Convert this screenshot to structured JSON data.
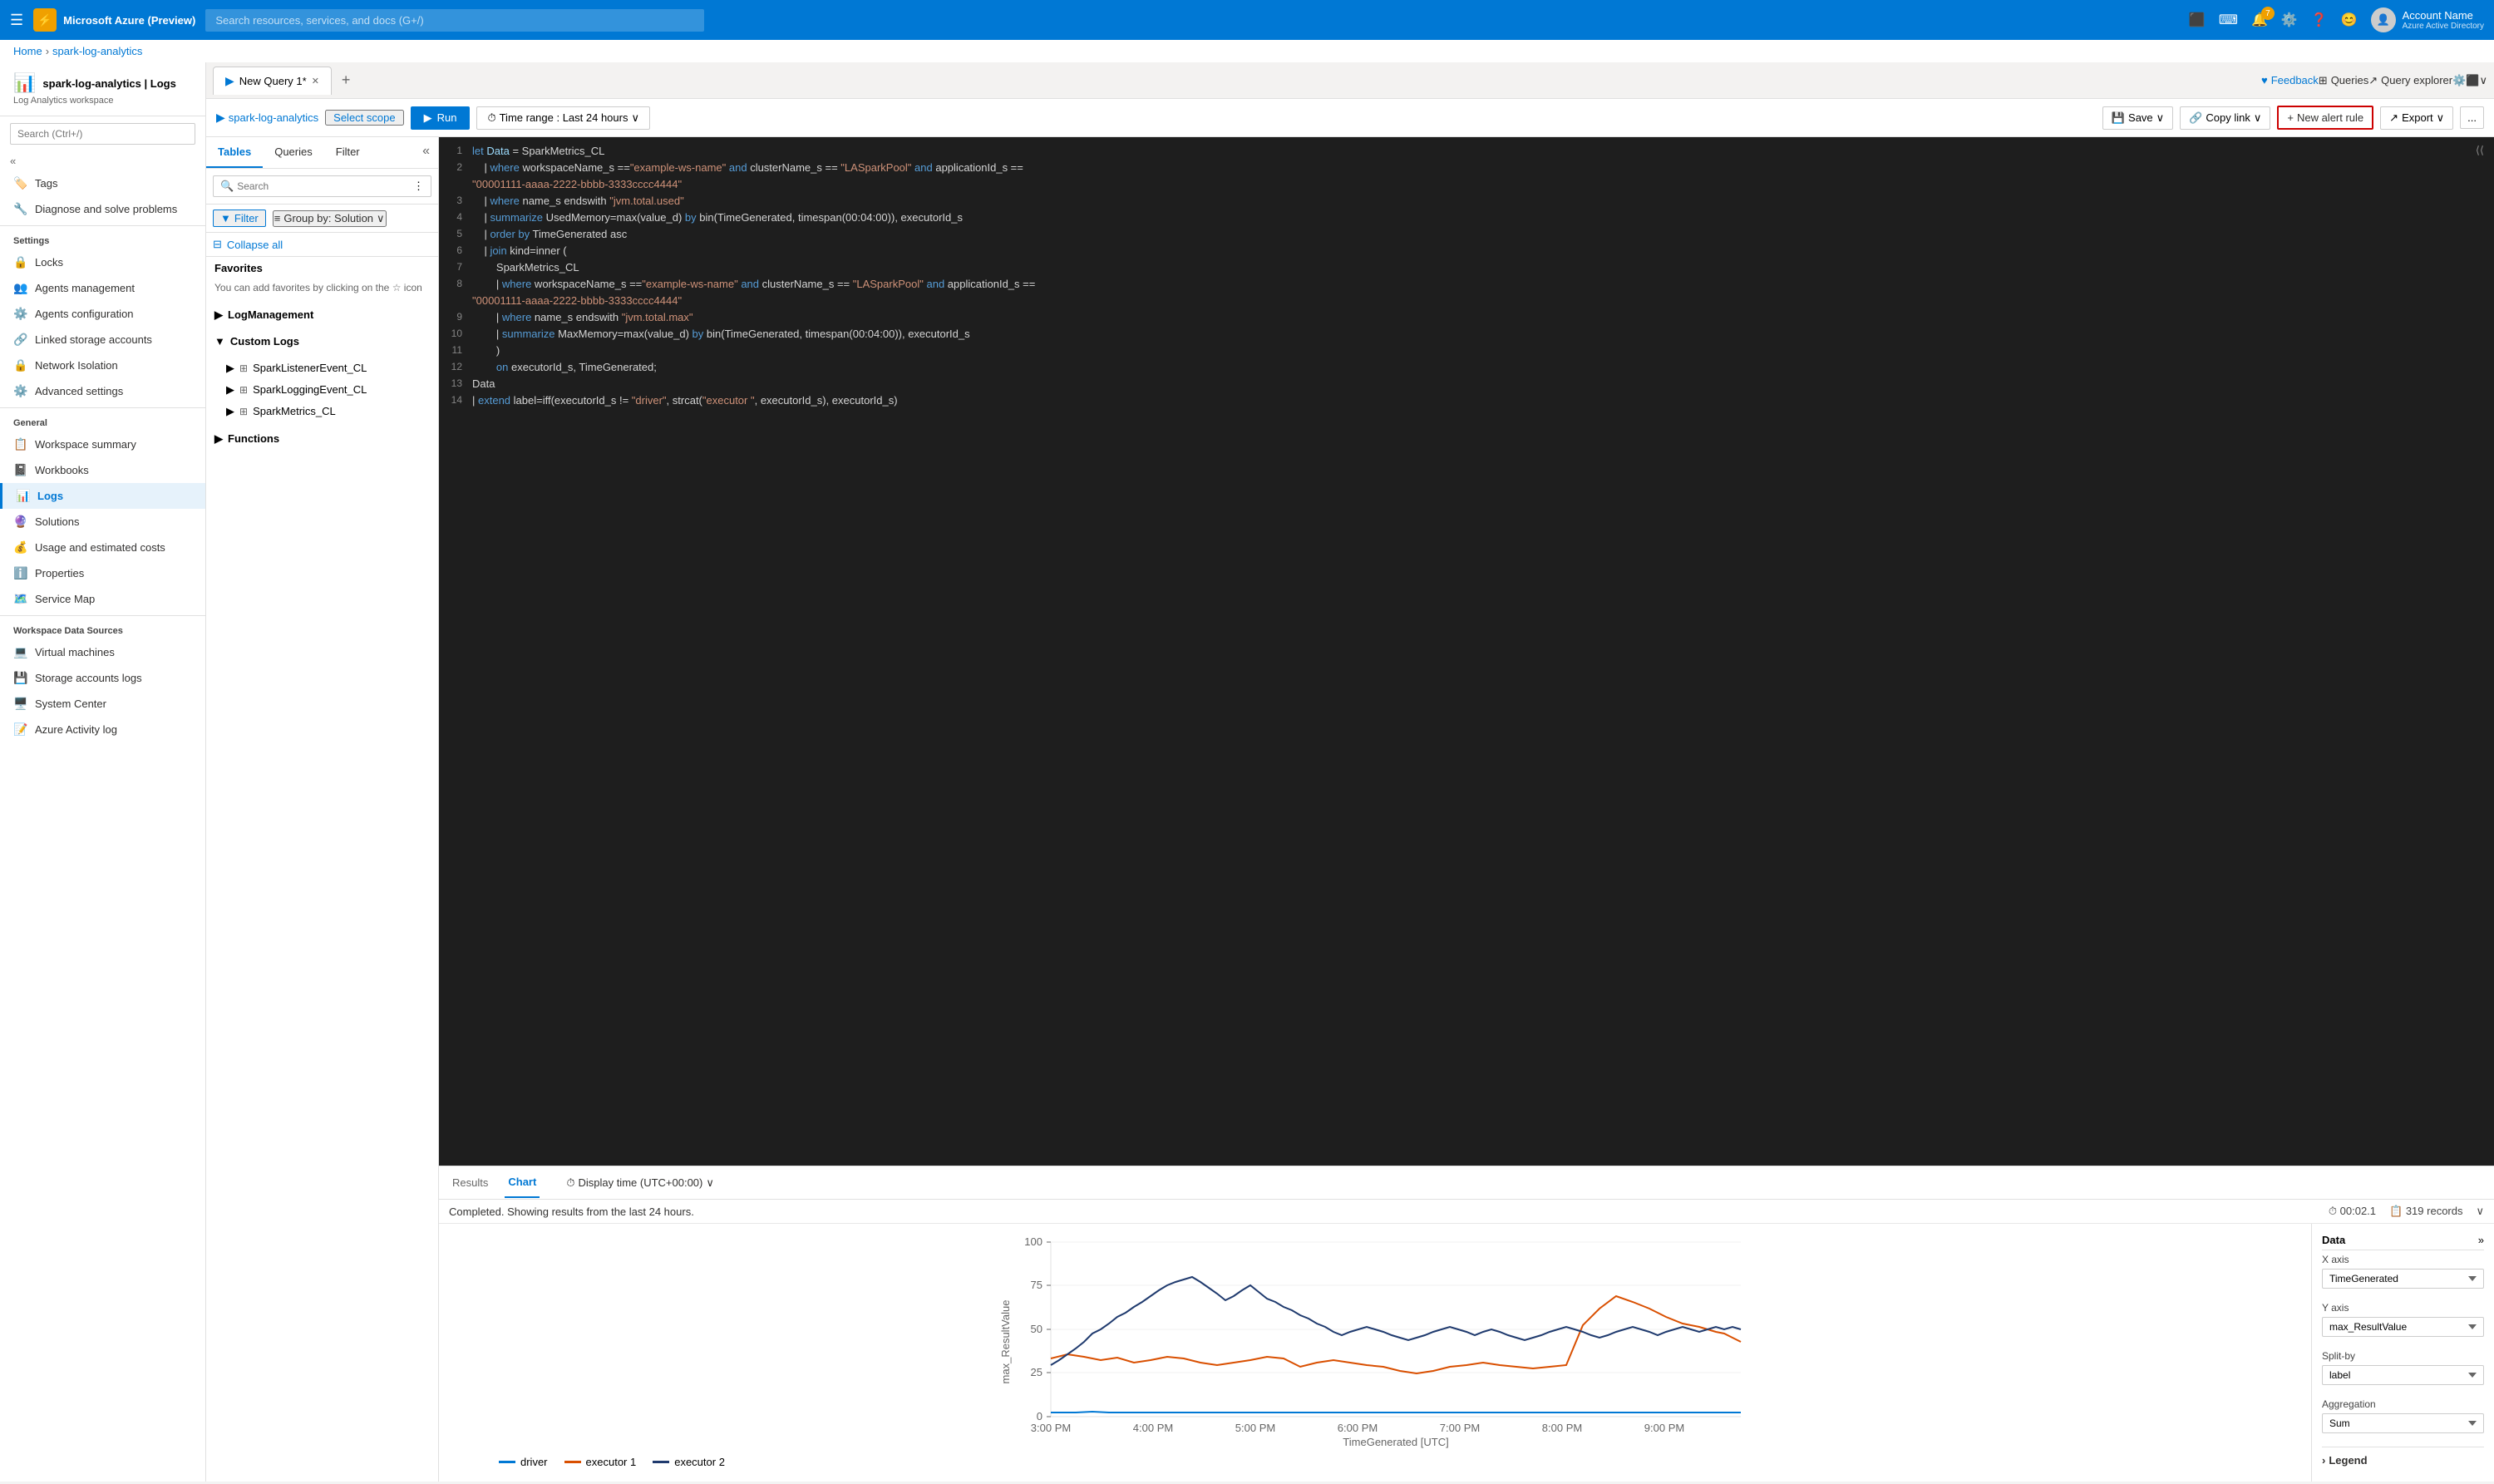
{
  "topbar": {
    "logo_icon": "⚡",
    "logo_text": "Microsoft Azure (Preview)",
    "search_placeholder": "Search resources, services, and docs (G+/)",
    "notification_count": "7",
    "account_name": "Account Name",
    "account_sub": "Azure Active Directory"
  },
  "breadcrumb": {
    "home": "Home",
    "resource": "spark-log-analytics"
  },
  "page": {
    "title": "spark-log-analytics | Logs",
    "subtitle": "Log Analytics workspace"
  },
  "sidebar": {
    "search_placeholder": "Search (Ctrl+/)",
    "items_top": [
      {
        "icon": "🏷️",
        "label": "Tags"
      },
      {
        "icon": "🔧",
        "label": "Diagnose and solve problems"
      }
    ],
    "settings_section": "Settings",
    "settings_items": [
      {
        "icon": "🔒",
        "label": "Locks"
      },
      {
        "icon": "👥",
        "label": "Agents management"
      },
      {
        "icon": "⚙️",
        "label": "Agents configuration"
      },
      {
        "icon": "🔗",
        "label": "Linked storage accounts"
      },
      {
        "icon": "🔒",
        "label": "Network Isolation"
      },
      {
        "icon": "⚙️",
        "label": "Advanced settings"
      }
    ],
    "general_section": "General",
    "general_items": [
      {
        "icon": "📋",
        "label": "Workspace summary"
      },
      {
        "icon": "📓",
        "label": "Workbooks"
      },
      {
        "icon": "📊",
        "label": "Logs",
        "active": true
      },
      {
        "icon": "🔮",
        "label": "Solutions"
      },
      {
        "icon": "💰",
        "label": "Usage and estimated costs"
      },
      {
        "icon": "ℹ️",
        "label": "Properties"
      },
      {
        "icon": "🗺️",
        "label": "Service Map"
      }
    ],
    "data_sources_section": "Workspace Data Sources",
    "data_source_items": [
      {
        "icon": "💻",
        "label": "Virtual machines"
      },
      {
        "icon": "💾",
        "label": "Storage accounts logs"
      },
      {
        "icon": "🖥️",
        "label": "System Center"
      },
      {
        "icon": "📝",
        "label": "Azure Activity log"
      }
    ]
  },
  "tabs": [
    {
      "label": "New Query 1*",
      "active": true
    }
  ],
  "query_toolbar": {
    "workspace": "spark-log-analytics",
    "scope_btn": "Select scope",
    "run_btn": "Run",
    "time_range": "Time range : Last 24 hours",
    "save_btn": "Save",
    "copy_link_btn": "Copy link",
    "new_alert_btn": "New alert rule",
    "export_btn": "Export",
    "more_btn": "...",
    "feedback_btn": "Feedback",
    "queries_btn": "Queries",
    "query_explorer_btn": "Query explorer"
  },
  "left_panel": {
    "tabs": [
      "Tables",
      "Queries",
      "Filter"
    ],
    "search_placeholder": "Search",
    "filter_btn": "Filter",
    "group_by_btn": "Group by: Solution",
    "collapse_all_btn": "Collapse all",
    "favorites_title": "Favorites",
    "favorites_desc": "You can add favorites by clicking on the ☆ icon",
    "log_management_section": "LogManagement",
    "custom_logs_section": "Custom Logs",
    "custom_log_tables": [
      "SparkListenerEvent_CL",
      "SparkLoggingEvent_CL",
      "SparkMetrics_CL"
    ],
    "functions_section": "Functions"
  },
  "editor": {
    "lines": [
      {
        "num": 1,
        "text": "let Data = SparkMetrics_CL"
      },
      {
        "num": 2,
        "text": "    | where workspaceName_s ==\"example-ws-name\" and clusterName_s == \"LASparkPool\" and applicationId_s =="
      },
      {
        "num": 2,
        "text": "\"00001111-aaaa-2222-bbbb-3333cccc4444\""
      },
      {
        "num": 3,
        "text": "    | where name_s endswith \"jvm.total.used\""
      },
      {
        "num": 4,
        "text": "    | summarize UsedMemory=max(value_d) by bin(TimeGenerated, timespan(00:04:00)), executorId_s"
      },
      {
        "num": 5,
        "text": "    | order by TimeGenerated asc"
      },
      {
        "num": 6,
        "text": "    | join kind=inner ("
      },
      {
        "num": 7,
        "text": "        SparkMetrics_CL"
      },
      {
        "num": 8,
        "text": "        | where workspaceName_s ==\"example-ws-name\" and clusterName_s == \"LASparkPool\" and applicationId_s =="
      },
      {
        "num": 8,
        "text": "\"00001111-aaaa-2222-bbbb-3333cccc4444\""
      },
      {
        "num": 9,
        "text": "        | where name_s endswith \"jvm.total.max\""
      },
      {
        "num": 10,
        "text": "        | summarize MaxMemory=max(value_d) by bin(TimeGenerated, timespan(00:04:00)), executorId_s"
      },
      {
        "num": 11,
        "text": "        )"
      },
      {
        "num": 12,
        "text": "        on executorId_s, TimeGenerated;"
      },
      {
        "num": 13,
        "text": "Data"
      },
      {
        "num": 14,
        "text": "| extend label=iff(executorId_s != \"driver\", strcat(\"executor \", executorId_s), executorId_s)"
      }
    ]
  },
  "results": {
    "tabs": [
      "Results",
      "Chart"
    ],
    "active_tab": "Chart",
    "display_time": "Display time (UTC+00:00)",
    "status_text": "Completed. Showing results from the last 24 hours.",
    "time_elapsed": "00:02.1",
    "record_count": "319 records",
    "chart_settings": {
      "x_axis_label": "X axis",
      "x_axis_value": "TimeGenerated",
      "y_axis_label": "Y axis",
      "y_axis_value": "max_ResultValue",
      "split_by_label": "Split-by",
      "split_by_value": "label",
      "aggregation_label": "Aggregation",
      "aggregation_value": "Sum"
    },
    "legend": {
      "title": "Legend",
      "items": [
        {
          "label": "driver",
          "color": "#0078d4"
        },
        {
          "label": "executor 1",
          "color": "#d94f00"
        },
        {
          "label": "executor 2",
          "color": "#1f3a6e"
        }
      ]
    },
    "chart": {
      "y_label": "max_ResultValue",
      "x_label": "TimeGenerated [UTC]",
      "y_max": 100,
      "y_ticks": [
        0,
        25,
        50,
        75,
        100
      ],
      "x_labels": [
        "3:00 PM",
        "4:00 PM",
        "5:00 PM",
        "6:00 PM",
        "7:00 PM",
        "8:00 PM",
        "9:00 PM"
      ]
    }
  }
}
